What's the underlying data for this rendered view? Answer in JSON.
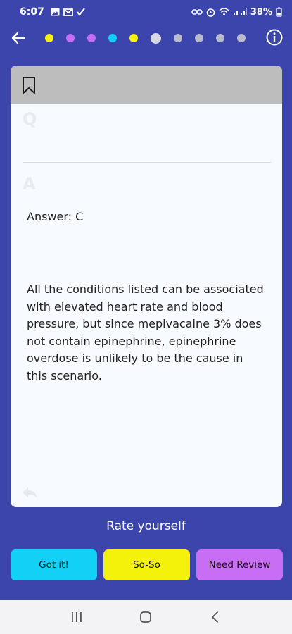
{
  "status_bar": {
    "time": "6:07",
    "battery": "38%",
    "left_icons": [
      "image-icon",
      "gmail-icon",
      "check-icon"
    ],
    "right_icons": [
      "link-icon",
      "alarm-icon",
      "wifi-icon",
      "signal-icon",
      "battery-icon"
    ]
  },
  "nav": {
    "progress_dots": [
      {
        "color": "#f3f30f",
        "current": false
      },
      {
        "color": "#c86ef4",
        "current": false
      },
      {
        "color": "#c86ef4",
        "current": false
      },
      {
        "color": "#12d0f6",
        "current": false
      },
      {
        "color": "#f3f30f",
        "current": false
      },
      {
        "color": "#d9d9e6",
        "current": true
      },
      {
        "color": "#b9bbcf",
        "current": false
      },
      {
        "color": "#b9bbcf",
        "current": false
      },
      {
        "color": "#b9bbcf",
        "current": false
      },
      {
        "color": "#b9bbcf",
        "current": false
      }
    ]
  },
  "card": {
    "question_letter": "Q",
    "answer_letter": "A",
    "answer_line": "Answer: C",
    "explanation": "All the conditions listed can be associated with elevated heart rate and blood pressure, but since mepivacaine 3% does not contain epinephrine, epinephrine overdose is unlikely to be the cause in this scenario."
  },
  "rating": {
    "label": "Rate yourself",
    "got_it": "Got it!",
    "so_so": "So-So",
    "need_review": "Need Review"
  },
  "colors": {
    "background": "#3b45ab",
    "got_it": "#12d0f6",
    "so_so": "#f4f20a",
    "need_review": "#c86ef4"
  }
}
